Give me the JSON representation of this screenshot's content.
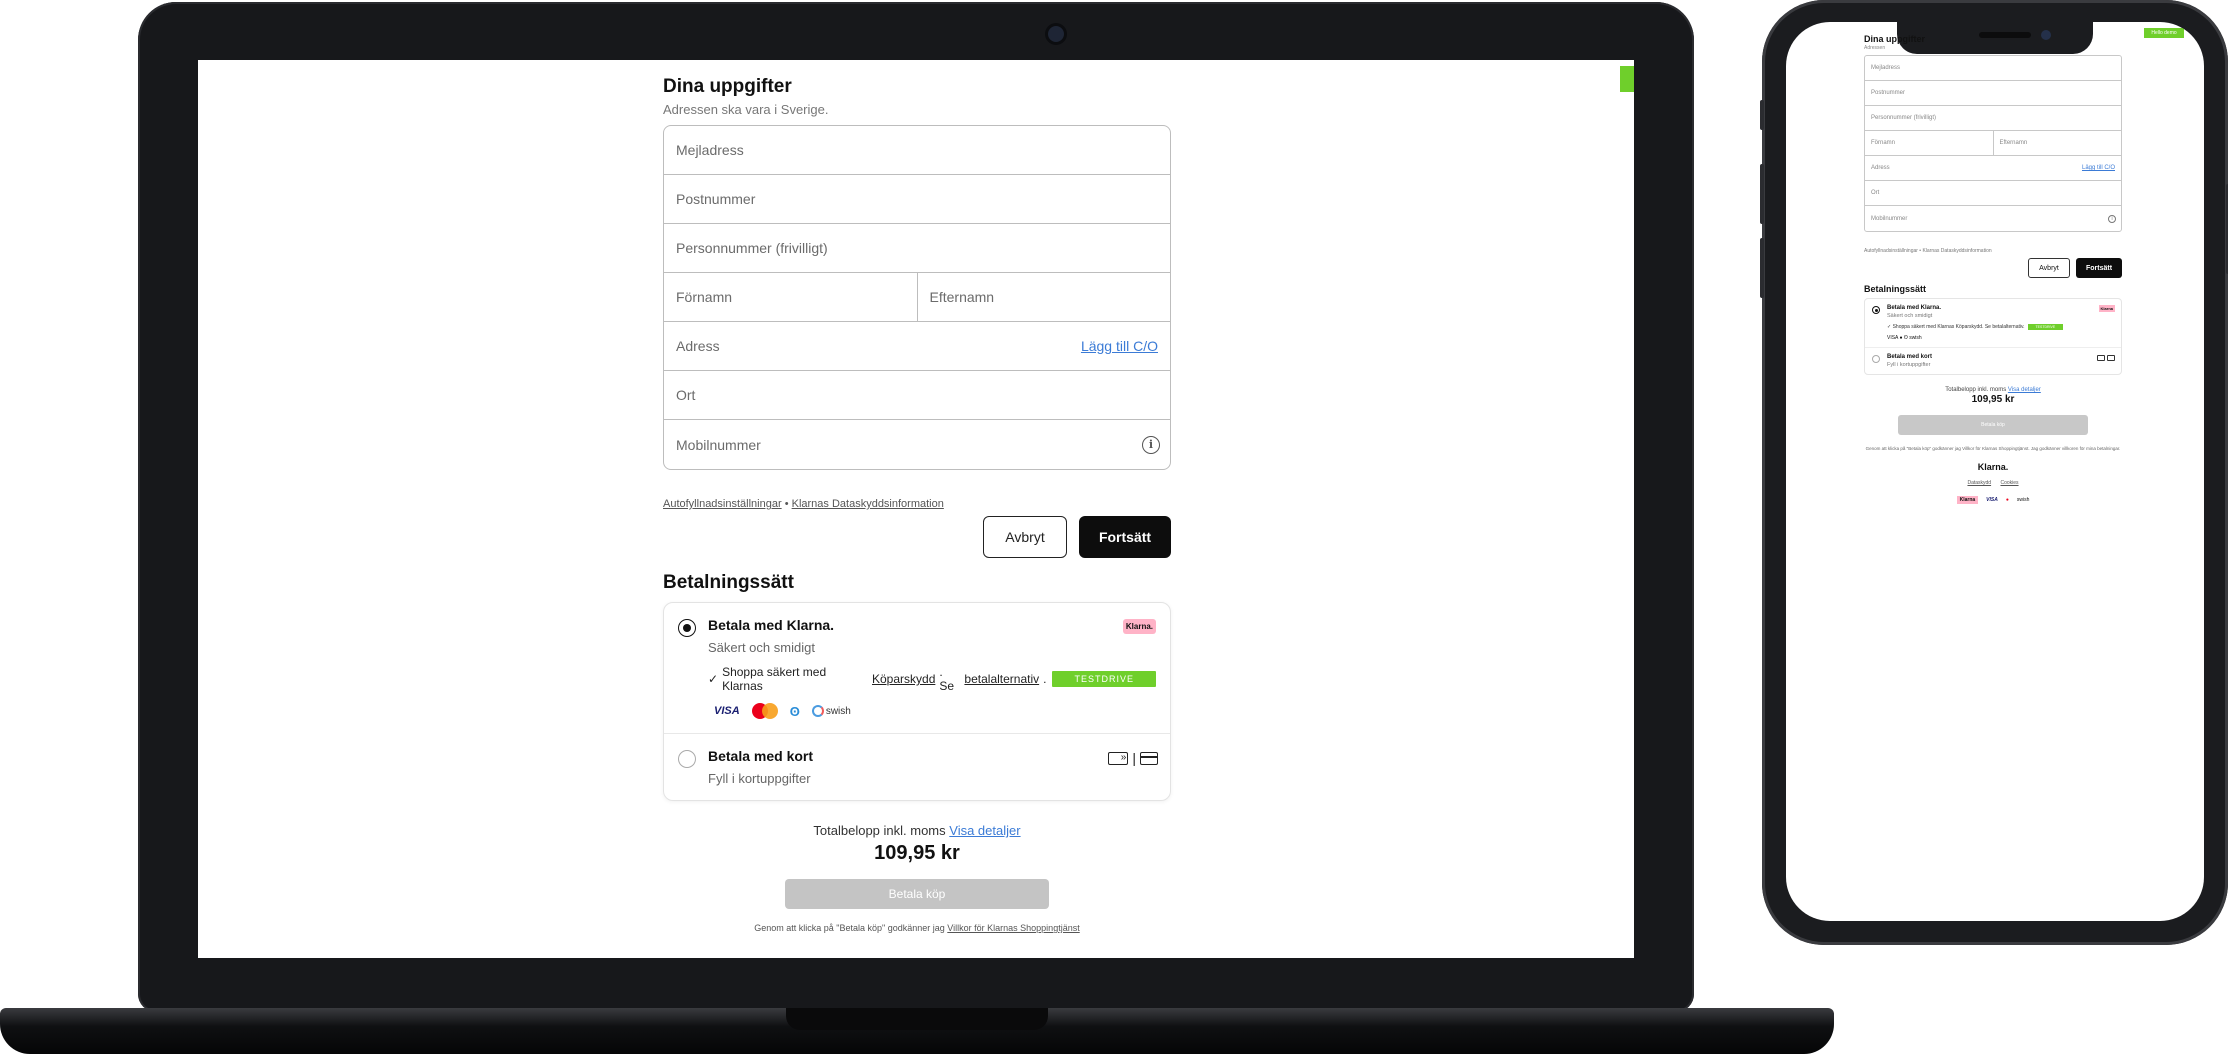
{
  "form": {
    "title": "Dina uppgifter",
    "subtitle": "Adressen ska vara i Sverige.",
    "email_ph": "Mejladress",
    "postal_ph": "Postnummer",
    "personal_ph": "Personnummer (frivilligt)",
    "firstname_ph": "Förnamn",
    "lastname_ph": "Efternamn",
    "address_ph": "Adress",
    "add_co": "Lägg till C/O",
    "city_ph": "Ort",
    "mobile_ph": "Mobilnummer",
    "info_icon": "i",
    "privacy_autofill": "Autofyllnadsinställningar",
    "privacy_sep": " • ",
    "privacy_klarna": "Klarnas Dataskyddsinformation",
    "cancel": "Avbryt",
    "continue": "Fortsätt"
  },
  "payment": {
    "title": "Betalningssätt",
    "klarna_title": "Betala med Klarna.",
    "klarna_sub": "Säkert och smidigt",
    "klarna_badge": "Klarna.",
    "shop_check": "✓",
    "shop_text": "Shoppa säkert med Klarnas",
    "shop_link": "Köparskydd",
    "shop_mid": ". Se",
    "shop_alt": "betalalternativ",
    "shop_end": ".",
    "testdrive": "TESTDRIVE",
    "logo_visa": "VISA",
    "logo_amex": "ʘ",
    "logo_swish": "swish",
    "card_title": "Betala med kort",
    "card_sub": "Fyll i kortuppgifter",
    "card_sep": "|"
  },
  "total": {
    "label": "Totalbelopp inkl. moms",
    "details": "Visa detaljer",
    "amount": "109,95 kr",
    "buy": "Betala köp",
    "terms_pre": "Genom att klicka på \"Betala köp\" godkänner jag",
    "terms_link": "Villkor för Klarnas Shoppingtjänst"
  },
  "phone": {
    "title": "Dina uppgifter",
    "subtitle": "Adressen",
    "green_tag": "Hello demo",
    "email_ph": "Mejladress",
    "postal_ph": "Postnummer",
    "personal_ph": "Personnummer (frivilligt)",
    "firstname_ph": "Förnamn",
    "lastname_ph": "Efternamn",
    "address_ph": "Adress",
    "add_co": "Lägg till C/O",
    "city_ph": "Ort",
    "mobile_ph": "Mobilnummer",
    "privacy": "Autofyllnadsinställningar • Klarnas Dataskyddsinformation",
    "cancel": "Avbryt",
    "continue": "Fortsätt",
    "pay_title": "Betalningssätt",
    "klarna_title": "Betala med Klarna.",
    "klarna_sub": "Säkert och smidigt",
    "klarna_badge": "Klarna",
    "shop_text": "✓ Shoppa säkert med Klarnas Köparskydd. Se betalalternativ.",
    "testdrive": "TESTDRIVE",
    "logos": "VISA ● ʘ swish",
    "card_title": "Betala med kort",
    "card_sub": "Fyll i kortuppgifter",
    "total_label": "Totalbelopp inkl. moms",
    "total_details": "Visa detaljer",
    "amount": "109,95 kr",
    "buy": "Betala köp",
    "terms": "Genom att klicka på \"Betala köp\" godkänner jag Villkor för Klarnas Shoppingtjänst. Jag godkänner villkoren för mina betalningar.",
    "klarna_logo": "Klarna.",
    "foot_link1": "Dataskydd",
    "foot_link2": "Cookies",
    "foot_visa": "VISA",
    "foot_mc": "●",
    "foot_swish": "swish"
  },
  "colors": {
    "accent_green": "#6fcf2b",
    "klarna_pink": "#ffb3c7",
    "link_blue": "#3b7bd6",
    "button_dark": "#0d0d0d",
    "button_disabled": "#c4c4c4"
  }
}
